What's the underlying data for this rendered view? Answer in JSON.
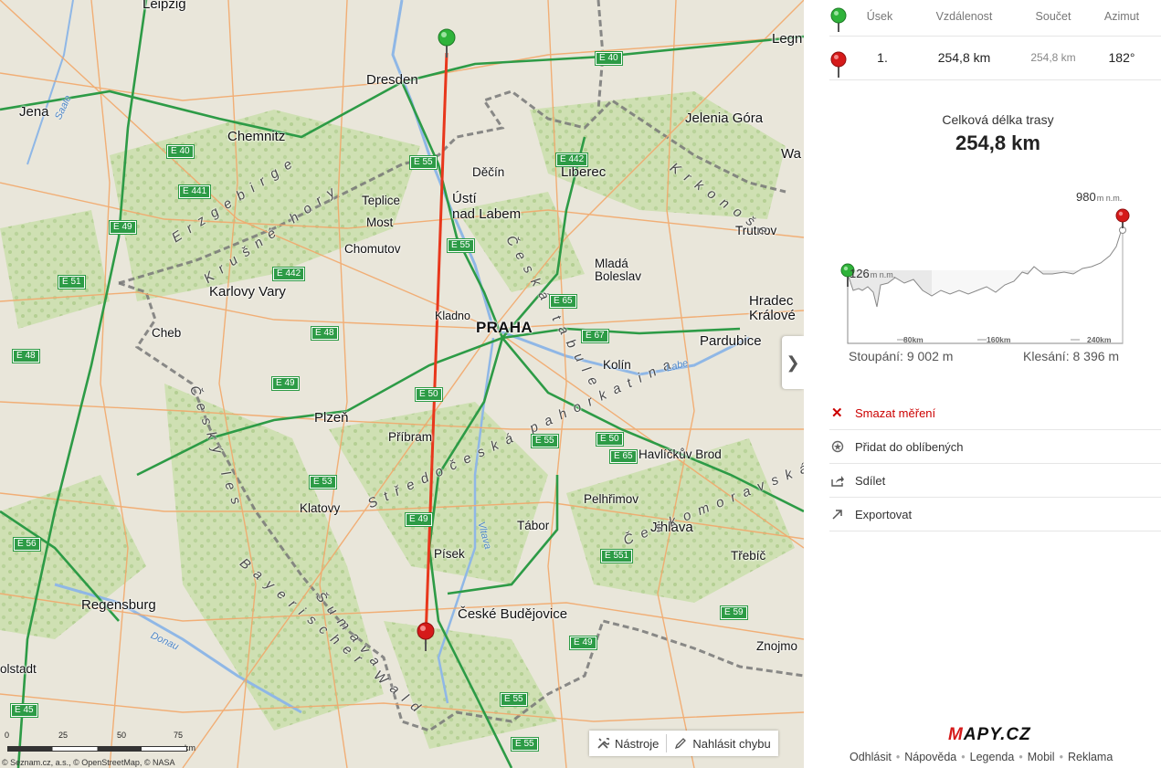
{
  "map": {
    "places": [
      {
        "name": "Leipzig"
      },
      {
        "name": "Dresden"
      },
      {
        "name": "Jena"
      },
      {
        "name": "Chemnitz"
      },
      {
        "name": "Legn"
      },
      {
        "name": "Jelenia Góra"
      },
      {
        "name": "Wa"
      },
      {
        "name": "Děčín"
      },
      {
        "name": "Liberec"
      },
      {
        "name": "Teplice"
      },
      {
        "name": "Most"
      },
      {
        "name": "Ústí"
      },
      {
        "name": "nad Labem"
      },
      {
        "name": "Chomutov"
      },
      {
        "name": "Trutnov"
      },
      {
        "name": "Karlovy Vary"
      },
      {
        "name": "Mladá"
      },
      {
        "name": "Boleslav"
      },
      {
        "name": "Cheb"
      },
      {
        "name": "Kladno"
      },
      {
        "name": "PRAHA"
      },
      {
        "name": "Hradec"
      },
      {
        "name": "Králové"
      },
      {
        "name": "Pardubice"
      },
      {
        "name": "Kolín"
      },
      {
        "name": "Plzeň"
      },
      {
        "name": "Příbram"
      },
      {
        "name": "Havlíčkův Brod"
      },
      {
        "name": "Klatovy"
      },
      {
        "name": "Pelhřimov"
      },
      {
        "name": "Tábor"
      },
      {
        "name": "Jihlava"
      },
      {
        "name": "Písek"
      },
      {
        "name": "Třebíč"
      },
      {
        "name": "Regensburg"
      },
      {
        "name": "České Budějovice"
      },
      {
        "name": "Znojmo"
      },
      {
        "name": "olstadt"
      }
    ],
    "regions": [
      "Erzgebirge",
      "Krušné hory",
      "Česká tabule",
      "Krkonoše",
      "Středočeská pahorkatina",
      "Český les",
      "Bayerischer Wald",
      "Šumava",
      "Českomoravská vrchovina"
    ],
    "rivers": [
      "Saale",
      "Labe",
      "Vltava",
      "Donau"
    ],
    "roads": [
      "E 40",
      "E 40",
      "E 55",
      "E 442",
      "E 441",
      "E 49",
      "E 55",
      "E 51",
      "E 442",
      "E 65",
      "E 48",
      "E 48",
      "E 67",
      "E 49",
      "E 50",
      "E 50",
      "E 55",
      "E 65",
      "E 53",
      "E 49",
      "E 56",
      "E 551",
      "E 59",
      "E 49",
      "E 45",
      "E 55",
      "E 55"
    ],
    "expand_icon": "chevron-right-icon",
    "tools_label": "Nástroje",
    "report_label": "Nahlásit chybu",
    "scale_ticks": [
      "0",
      "25",
      "50",
      "75"
    ],
    "scale_unit": "km",
    "copyright": "© Seznam.cz, a.s., © OpenStreetMap, © NASA",
    "route_color": "#e8371c",
    "start_pin_color": "#2fb33a",
    "end_pin_color": "#d51a1a"
  },
  "panel": {
    "columns": {
      "segment": "Úsek",
      "distance": "Vzdálenost",
      "sum": "Součet",
      "azimuth": "Azimut"
    },
    "segments": [
      {
        "index": "1.",
        "distance": "254,8 km",
        "sum": "254,8 km",
        "azimuth": "182°"
      }
    ],
    "total_label": "Celková délka trasy",
    "total_value": "254,8 km",
    "profile": {
      "min_label": "126",
      "max_label": "980",
      "unit": "m n.m.",
      "ticks": [
        "80km",
        "160km",
        "240km"
      ],
      "ascent": "Stoupání: 9 002 m",
      "descent": "Klesání: 8 396 m"
    },
    "actions": [
      {
        "label": "Smazat měření",
        "icon": "close-icon"
      },
      {
        "label": "Přidat do oblíbených",
        "icon": "favorites-icon"
      },
      {
        "label": "Sdílet",
        "icon": "share-icon"
      },
      {
        "label": "Exportovat",
        "icon": "export-icon"
      }
    ],
    "logo": "MAPY.CZ",
    "footer_links": [
      "Odhlásit",
      "Nápověda",
      "Legenda",
      "Mobil",
      "Reklama"
    ]
  }
}
